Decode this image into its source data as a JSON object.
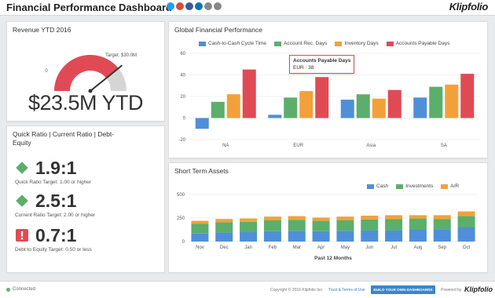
{
  "header": {
    "title": "Financial Performance Dashboard",
    "brand": "Klipfolio",
    "share_icons": [
      {
        "name": "twitter-icon",
        "color": "#1da1f2"
      },
      {
        "name": "google-plus-icon",
        "color": "#dd4b39"
      },
      {
        "name": "facebook-icon",
        "color": "#3b5998"
      },
      {
        "name": "linkedin-icon",
        "color": "#0077b5"
      },
      {
        "name": "email-icon",
        "color": "#888888"
      },
      {
        "name": "link-icon",
        "color": "#888888"
      }
    ]
  },
  "revenue": {
    "title": "Revenue YTD 2016",
    "value": "$23.5M YTD",
    "gauge_min": "0",
    "target_label": "Target: $30.0M",
    "current": 23.5,
    "target": 30.0,
    "colors": {
      "fill": "#e04a55",
      "remaining": "#d5d5d5"
    }
  },
  "ratios": {
    "title": "Quick Ratio | Current Ratio | Debt-Equity",
    "items": [
      {
        "value": "1.9:1",
        "target": "Quick Ratio Target: 1.00 or higher",
        "status": "good",
        "icon": "diamond-icon"
      },
      {
        "value": "2.5:1",
        "target": "Current Ratio Target: 2.00 or higher",
        "status": "good",
        "icon": "diamond-icon"
      },
      {
        "value": "0.7:1",
        "target": "Debt to Equity Target: 0.50 or less",
        "status": "alert",
        "icon": "alert-icon"
      }
    ],
    "colors": {
      "good": "#5cae6b",
      "alert": "#e04a55"
    }
  },
  "global": {
    "title": "Global Financial Performance",
    "tooltip": {
      "title": "Accounts Payable Days",
      "text": "EUR : 38"
    }
  },
  "short_term": {
    "title": "Short Term Assets"
  },
  "chart_data": [
    {
      "type": "bar",
      "title": "Global Financial Performance",
      "categories": [
        "NA",
        "EUR",
        "Asia",
        "SA"
      ],
      "series": [
        {
          "name": "Cash-to-Cash Cycle Time",
          "color": "#4f8fd9",
          "values": [
            -10,
            3,
            17,
            19
          ]
        },
        {
          "name": "Account Rec. Days",
          "color": "#5cae6b",
          "values": [
            15,
            19,
            22,
            29
          ]
        },
        {
          "name": "Inventory Days",
          "color": "#f2a13a",
          "values": [
            22,
            25,
            18,
            31
          ]
        },
        {
          "name": "Accounts Payable Days",
          "color": "#e04a55",
          "values": [
            45,
            38,
            26,
            41
          ]
        }
      ],
      "ylim": [
        -20,
        60
      ],
      "yticks": [
        -20,
        0,
        20,
        40,
        60
      ],
      "grid": true,
      "legend": "top"
    },
    {
      "type": "bar",
      "stacked": true,
      "title": "Short Term Assets",
      "xlabel": "Past 12 Months",
      "categories": [
        "Nov",
        "Dec",
        "Jan",
        "Feb",
        "Mar",
        "Apr",
        "May",
        "Jun",
        "Jul",
        "Aug",
        "Sep",
        "Oct"
      ],
      "series": [
        {
          "name": "Cash",
          "color": "#4f8fd9",
          "values": [
            85,
            95,
            100,
            110,
            115,
            110,
            115,
            120,
            120,
            125,
            130,
            150
          ]
        },
        {
          "name": "Investments",
          "color": "#5cae6b",
          "values": [
            105,
            110,
            110,
            115,
            115,
            110,
            110,
            115,
            120,
            120,
            110,
            120
          ]
        },
        {
          "name": "A/R",
          "color": "#f2a13a",
          "values": [
            30,
            35,
            35,
            40,
            40,
            35,
            40,
            40,
            40,
            35,
            40,
            50
          ]
        }
      ],
      "ylim": [
        0,
        500
      ],
      "yticks": [
        0,
        250,
        500
      ],
      "grid": true,
      "legend": "top-right"
    }
  ],
  "footer": {
    "status": "Connected",
    "copyright": "Copyright © 2016 Klipfolio Inc.",
    "terms": "Trust & Terms of Use",
    "cta": "BUILD YOUR OWN DASHBOARDS",
    "powered_by": "Powered by",
    "brand": "Klipfolio"
  }
}
